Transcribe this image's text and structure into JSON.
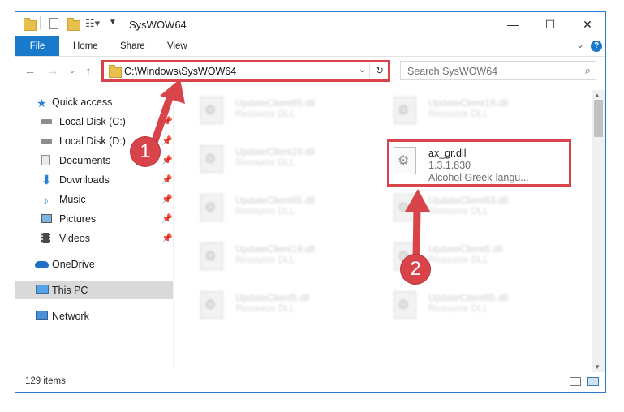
{
  "window": {
    "title": "SysWOW64",
    "controls": {
      "minimize": "—",
      "maximize": "☐",
      "close": "✕"
    }
  },
  "ribbon": {
    "tabs": [
      "File",
      "Home",
      "Share",
      "View"
    ],
    "help_label": "?"
  },
  "address_bar": {
    "path": "C:\\Windows\\SysWOW64"
  },
  "search": {
    "placeholder": "Search SysWOW64"
  },
  "sidebar": {
    "items": [
      {
        "label": "Quick access",
        "icon": "star-icon",
        "pinned": false
      },
      {
        "label": "Local Disk (C:)",
        "icon": "drive-icon",
        "pinned": true
      },
      {
        "label": "Local Disk (D:)",
        "icon": "drive-icon",
        "pinned": true
      },
      {
        "label": "Documents",
        "icon": "documents-icon",
        "pinned": true
      },
      {
        "label": "Downloads",
        "icon": "download-arrow-icon",
        "pinned": true
      },
      {
        "label": "Music",
        "icon": "music-note-icon",
        "pinned": true
      },
      {
        "label": "Pictures",
        "icon": "pictures-icon",
        "pinned": true
      },
      {
        "label": "Videos",
        "icon": "film-icon",
        "pinned": true
      },
      {
        "label": "OneDrive",
        "icon": "cloud-icon",
        "pinned": false
      },
      {
        "label": "This PC",
        "icon": "monitor-icon",
        "pinned": false,
        "selected": true
      },
      {
        "label": "Network",
        "icon": "network-icon",
        "pinned": false
      }
    ],
    "pin_glyph": "📌"
  },
  "files": {
    "items": [
      {
        "name": "UpdateClient65.dll",
        "desc": "Resource DLL"
      },
      {
        "name": "UpdateClient19.dll",
        "desc": "Resource DLL"
      },
      {
        "name": "UpdateClient19.dll",
        "desc": "Resource DLL"
      },
      {
        "name": "ax_gr.dll",
        "version": "1.3.1.830",
        "desc": "Alcohol Greek-langu..."
      },
      {
        "name": "UpdateClient65.dll",
        "desc": "Resource DLL"
      },
      {
        "name": "UpdateClient63.dll",
        "desc": "Resource DLL"
      },
      {
        "name": "UpdateClient19.dll",
        "desc": "Resource DLL"
      },
      {
        "name": "UpdateClient5.dll",
        "desc": "Resource DLL"
      },
      {
        "name": "UpdateClient5.dll",
        "desc": "Resource DLL"
      },
      {
        "name": "UpdateClient65.dll",
        "desc": "Resource DLL"
      }
    ]
  },
  "status_bar": {
    "item_count": "129 items"
  },
  "annotations": {
    "marker_1": "1",
    "marker_2": "2",
    "color": "#d9444a"
  },
  "colors": {
    "accent": "#1979ca",
    "highlight": "#d9444a"
  }
}
